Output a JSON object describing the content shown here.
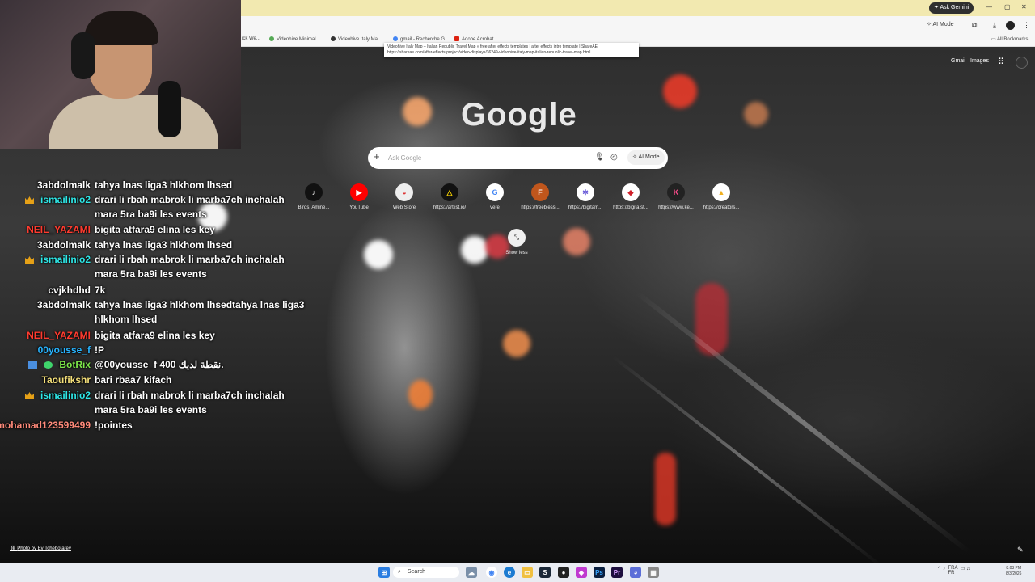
{
  "browser": {
    "ask_gemini": "Ask Gemini",
    "ai_mode_top": "AI Mode",
    "window_buttons": [
      "—",
      "▢",
      "✕"
    ],
    "toolbar_icons": [
      "puzzle-icon",
      "download-icon",
      "profile-icon",
      "menu-icon"
    ],
    "bookmarks": [
      {
        "label": "ick We..."
      },
      {
        "label": "Videohive Minimal..."
      },
      {
        "label": "Videohive Italy Ma..."
      },
      {
        "label": "gmail - Recherche G..."
      },
      {
        "label": "Adobe Acrobat"
      }
    ],
    "all_bookmarks": "All Bookmarks",
    "tooltip": {
      "line1": "Videohive Italy Map – Italian Republic Travel Map » free after effects templates | after effects intro template | ShareAE",
      "line2": "https://shareae.com/after-effects-project/video-displays/36249-videohive-italy-map-italian-republic-travel-map.html"
    }
  },
  "ntp": {
    "gmail": "Gmail",
    "images": "Images",
    "logo": "Google",
    "search_placeholder": "Ask Google",
    "ai_mode": "AI Mode",
    "shortcuts": [
      {
        "label": "Birds, Amine...",
        "glyph": "♪",
        "bg": "#111111",
        "fg": "#ffffff"
      },
      {
        "label": "YouTube",
        "glyph": "▶",
        "bg": "#ff0000",
        "fg": "#ffffff"
      },
      {
        "label": "Web Store",
        "glyph": "◒",
        "bg": "#eeeeee",
        "fg": "#d33"
      },
      {
        "label": "https://artlist.io/",
        "glyph": "△",
        "bg": "#111111",
        "fg": "#f5d000"
      },
      {
        "label": "vere",
        "glyph": "G",
        "bg": "#ffffff",
        "fg": "#4285f4"
      },
      {
        "label": "https://freebiess...",
        "glyph": "F",
        "bg": "#c0561c",
        "fg": "#ffffff"
      },
      {
        "label": "https://bigitam...",
        "glyph": "✲",
        "bg": "#ffffff",
        "fg": "#6a5cd8"
      },
      {
        "label": "https://bigita.st...",
        "glyph": "◆",
        "bg": "#ffffff",
        "fg": "#d0202a"
      },
      {
        "label": "https://www.ke...",
        "glyph": "K",
        "bg": "#222222",
        "fg": "#ff4d8d"
      },
      {
        "label": "https://creators...",
        "glyph": "▲",
        "bg": "#ffffff",
        "fg": "#f0b020"
      }
    ],
    "show_less": "Show less",
    "photo_credit": "Photo by Ev Tchebotarev"
  },
  "chat": [
    {
      "user": "3abdolmalk",
      "color": "#ffffff",
      "badges": [],
      "text": "tahya lnas liga3 hlkhom lhsed"
    },
    {
      "user": "ismailinio2",
      "color": "#2ee8e8",
      "badges": [
        "crown"
      ],
      "text": "drari li rbah mabrok li marba7ch inchalah mara 5ra ba9i les events"
    },
    {
      "user": "NEIL_YAZAMI",
      "color": "#ff3b2f",
      "badges": [],
      "text": "bigita atfara9 elina les key"
    },
    {
      "user": "3abdolmalk",
      "color": "#ffffff",
      "badges": [],
      "text": "tahya lnas liga3 hlkhom lhsed"
    },
    {
      "user": "ismailinio2",
      "color": "#2ee8e8",
      "badges": [
        "crown"
      ],
      "text": "drari li rbah mabrok li marba7ch inchalah mara 5ra ba9i les events"
    },
    {
      "user": "cvjkhdhd",
      "color": "#ffffff",
      "badges": [],
      "text": "7k"
    },
    {
      "user": "3abdolmalk",
      "color": "#ffffff",
      "badges": [],
      "text": "tahya lnas liga3 hlkhom lhsedtahya lnas liga3 hlkhom lhsed"
    },
    {
      "user": "NEIL_YAZAMI",
      "color": "#ff3b2f",
      "badges": [],
      "text": "bigita atfara9 elina les key"
    },
    {
      "user": "00yousse_f",
      "color": "#28b4ff",
      "badges": [],
      "text": "!P"
    },
    {
      "user": "BotRix",
      "color": "#7de84a",
      "badges": [
        "bot1",
        "bot2"
      ],
      "text": "@00yousse_f 400 نقطة لديك."
    },
    {
      "user": "Taoufikshr",
      "color": "#f5e07a",
      "badges": [],
      "text": "bari rbaa7 kifach"
    },
    {
      "user": "ismailinio2",
      "color": "#2ee8e8",
      "badges": [
        "crown"
      ],
      "text": "drari li rbah mabrok li marba7ch inchalah mara 5ra ba9i les events"
    },
    {
      "user": "mohamad123599499",
      "color": "#ff8a7a",
      "badges": [],
      "text": "!pointes"
    }
  ],
  "taskbar": {
    "search": "Search",
    "lang": "FRA\nFR",
    "time": "8:03 PM",
    "date": "8/3/2026"
  }
}
